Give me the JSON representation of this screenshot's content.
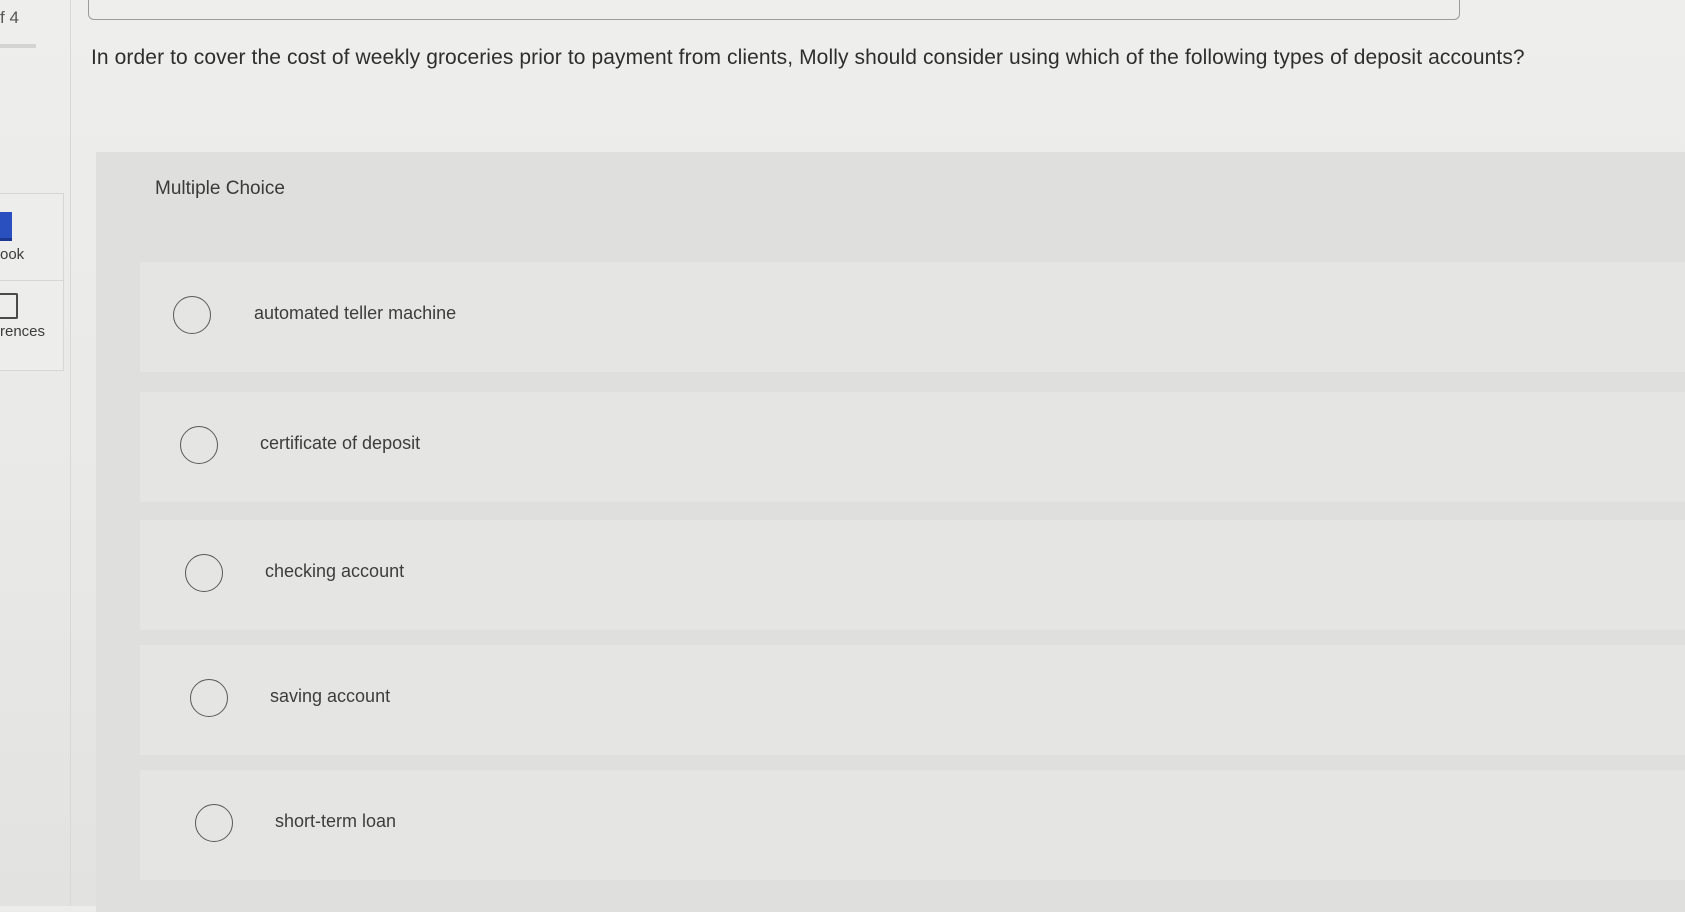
{
  "sidebar": {
    "question_counter": "f 4",
    "items": [
      {
        "label": "ook",
        "icon": "book-icon"
      },
      {
        "label": "rences",
        "icon": "references-icon"
      }
    ]
  },
  "question": {
    "text": "In order to cover the cost of weekly groceries prior to payment from clients, Molly should consider using which of the following types of deposit accounts?"
  },
  "choices": {
    "heading": "Multiple Choice",
    "options": [
      {
        "label": "automated teller machine"
      },
      {
        "label": "certificate of deposit"
      },
      {
        "label": "checking account"
      },
      {
        "label": "saving account"
      },
      {
        "label": "short-term loan"
      }
    ]
  }
}
